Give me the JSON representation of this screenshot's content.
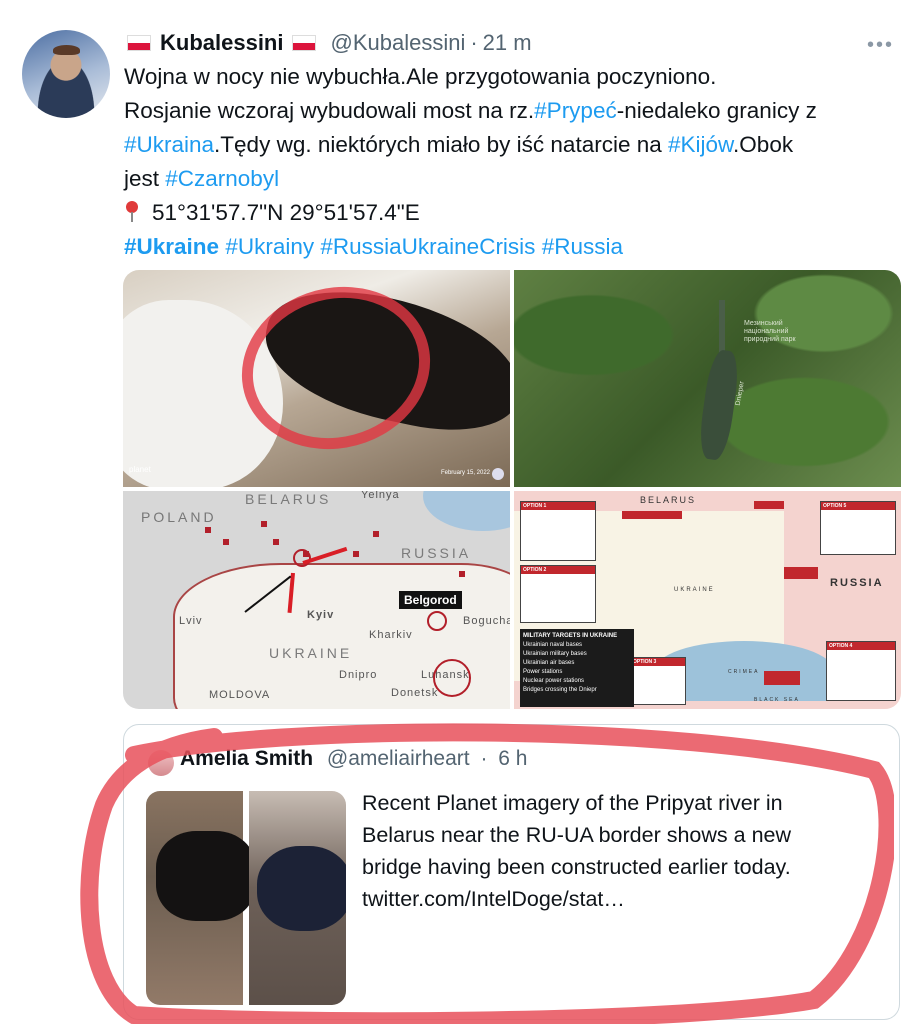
{
  "tweet": {
    "author": {
      "flag_icon": "poland-flag-icon",
      "name": "Kubalessini",
      "handle": "@Kubalessini",
      "separator": "·",
      "time": "21 m"
    },
    "more_icon": "more-options-icon",
    "more_glyph": "•••",
    "text_lines": [
      [
        "Wojna w nocy nie wybuchła.Ale przygotowania poczyniono."
      ],
      [
        "Rosjanie wczoraj wybudowali most na rz.",
        "#Prypeć",
        "-niedaleko granicy z"
      ],
      [
        "#Ukraina",
        ".Tędy wg. niektórych miało by iść natarcie na ",
        "#Kijów",
        ".Obok"
      ],
      [
        "jest ",
        "#Czarnobyl"
      ],
      [
        "51°31'57.7\"N 29°51'57.4\"E"
      ],
      [
        "#Ukraine",
        " ",
        "#Ukrainy",
        " ",
        "#RussiaUkraineCrisis",
        " ",
        "#Russia"
      ]
    ],
    "pin_icon": "location-pin-icon",
    "media": {
      "image1": {
        "brand": "planet",
        "date": "February 15, 2022"
      },
      "image2": {
        "labels": [
          "Dnieper",
          "Мезинський національний природний парк"
        ]
      },
      "image3": {
        "labels": {
          "belarus": "BELARUS",
          "poland": "POLAND",
          "russia": "RUSSIA",
          "ukraine": "UKRAINE",
          "yelnya": "Yelnya",
          "lviv": "Lviv",
          "kyiv": "Kyiv",
          "kharkiv": "Kharkiv",
          "dnipro": "Dnipro",
          "donetsk": "Donetsk",
          "luhansk": "Luhansk",
          "boguchar": "Boguchar",
          "moldova": "MOLDOVA",
          "belgorod": "Belgorod"
        }
      },
      "image4": {
        "belarus": "BELARUS",
        "russia": "RUSSIA",
        "ukraine": "UKRAINE",
        "black_sea": "BLACK SEA",
        "crimea": "CRIMEA",
        "option1": "OPTION 1",
        "option2": "OPTION 2",
        "option3": "OPTION 3",
        "option4": "OPTION 4",
        "option5": "OPTION 5",
        "legend_title": "MILITARY TARGETS IN UKRAINE",
        "legend_items": [
          "Ukrainian naval bases",
          "Ukrainian military bases",
          "Ukrainian air bases",
          "Power stations",
          "Nuclear power stations",
          "Bridges crossing the Dniepr"
        ]
      }
    }
  },
  "quote": {
    "avatar_icon": "quoted-user-avatar",
    "name": "Amelia Smith",
    "handle": "@ameliairheart",
    "separator": "·",
    "time": "6 h",
    "text_lines": [
      "Recent Planet imagery of the Pripyat river in",
      "Belarus near the RU-UA border shows a new",
      "bridge having been constructed earlier today.",
      "twitter.com/IntelDoge/stat…"
    ]
  },
  "colors": {
    "link": "#1d9bf0",
    "secondary_text": "#536471",
    "annotation_red": "#e8505b"
  }
}
